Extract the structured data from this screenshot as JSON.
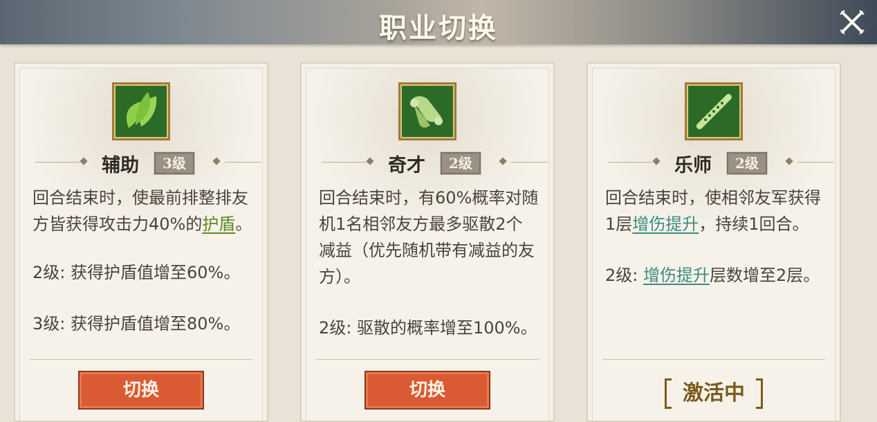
{
  "header": {
    "title": "职业切换",
    "close_icon": "close-x-icon"
  },
  "colors": {
    "accent_button": "#d95a33",
    "keyword_green": "#5c8a26",
    "keyword_teal": "#3c8c80",
    "badge_green": "#2c6b27"
  },
  "cards": [
    {
      "icon": "leaf-icon",
      "name": "辅助",
      "level": "3级",
      "desc1_a": "回合结束时，使最前排整排友方皆获得攻击力40%的",
      "desc1_kw": "护盾",
      "desc1_b": "。",
      "desc2": "2级: 获得护盾值增至60%。",
      "desc3": "3级: 获得护盾值增至80%。",
      "button": "切换"
    },
    {
      "icon": "scroll-icon",
      "name": "奇才",
      "level": "2级",
      "desc1": "回合结束时，有60%概率对随机1名相邻友方最多驱散2个减益（优先随机带有减益的友方）。",
      "desc2": "2级: 驱散的概率增至100%。",
      "button": "切换"
    },
    {
      "icon": "flute-icon",
      "name": "乐师",
      "level": "2级",
      "desc1_a": "回合结束时，使相邻友军获得1层",
      "desc1_kw": "增伤提升",
      "desc1_b": "，持续1回合。",
      "desc2_kw": "增伤提升",
      "desc2_b": "层数增至2层。",
      "desc2_a": "2级: ",
      "status": "激活中"
    }
  ]
}
